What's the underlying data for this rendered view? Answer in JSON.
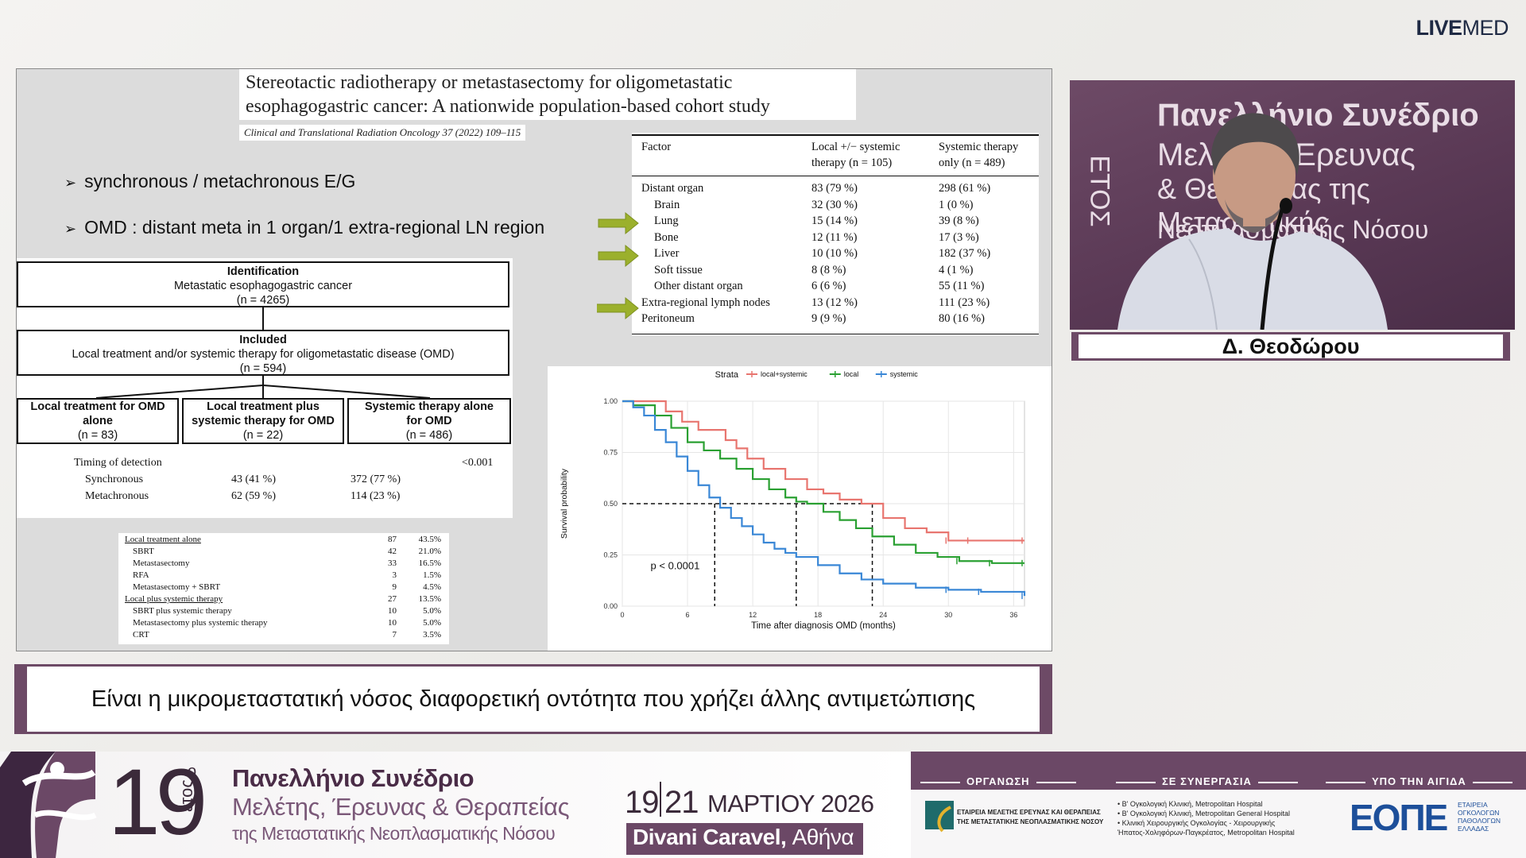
{
  "brand": {
    "live": "LIVE",
    "med": "MED"
  },
  "slide": {
    "paper_title_line1": "Stereotactic radiotherapy or metastasectomy for oligometastatic",
    "paper_title_line2": "esophagogastric cancer: A nationwide population-based cohort study",
    "journal": "Clinical and Translational Radiation Oncology 37 (2022) 109–115",
    "bullets": [
      "synchronous / metachronous E/G",
      "OMD : distant meta in 1 organ/1 extra-regional LN region"
    ],
    "flow": {
      "identification_title": "Identification",
      "identification_text": "Metastatic esophagogastric cancer",
      "identification_n": "(n = 4265)",
      "included_title": "Included",
      "included_text": "Local treatment and/or systemic therapy for oligometastatic disease (OMD)",
      "included_n": "(n = 594)",
      "branches": [
        {
          "line1": "Local treatment for OMD",
          "line2": "alone",
          "n": "(n = 83)"
        },
        {
          "line1": "Local treatment plus",
          "line2": "systemic therapy for OMD",
          "n": "(n = 22)"
        },
        {
          "line1": "Systemic therapy alone",
          "line2": "for OMD",
          "n": "(n = 486)"
        }
      ],
      "timing_label": "Timing of detection",
      "timing_p": "<0.001",
      "timing_rows": [
        {
          "label": "Synchronous",
          "a": "43 (41 %)",
          "b": "372 (77 %)"
        },
        {
          "label": "Metachronous",
          "a": "62 (59 %)",
          "b": "114 (23 %)"
        }
      ]
    },
    "treatment_table": [
      {
        "label": "Local treatment alone",
        "n": "87",
        "p": "43.5%",
        "head": true
      },
      {
        "label": "SBRT",
        "n": "42",
        "p": "21.0%"
      },
      {
        "label": "Metastasectomy",
        "n": "33",
        "p": "16.5%"
      },
      {
        "label": "RFA",
        "n": "3",
        "p": "1.5%"
      },
      {
        "label": "Metastasectomy + SBRT",
        "n": "9",
        "p": "4.5%"
      },
      {
        "label": "Local plus systemic therapy",
        "n": "27",
        "p": "13.5%",
        "head": true
      },
      {
        "label": "SBRT plus systemic therapy",
        "n": "10",
        "p": "5.0%"
      },
      {
        "label": "Metastasectomy plus systemic therapy",
        "n": "10",
        "p": "5.0%"
      },
      {
        "label": "CRT",
        "n": "7",
        "p": "3.5%"
      }
    ],
    "factor_table": {
      "headers": [
        "Factor",
        "Local +/− systemic",
        "therapy (n = 105)",
        "Systemic therapy",
        "only (n = 489)"
      ],
      "rows": [
        {
          "label": "Distant organ",
          "a": "83 (79 %)",
          "b": "298 (61 %)",
          "indent": false
        },
        {
          "label": "Brain",
          "a": "32 (30 %)",
          "b": "1 (0 %)",
          "indent": true
        },
        {
          "label": "Lung",
          "a": "15 (14 %)",
          "b": "39 (8 %)",
          "indent": true,
          "arrow": true
        },
        {
          "label": "Bone",
          "a": "12 (11 %)",
          "b": "17 (3 %)",
          "indent": true
        },
        {
          "label": "Liver",
          "a": "10 (10 %)",
          "b": "182 (37 %)",
          "indent": true,
          "arrow": true
        },
        {
          "label": "Soft tissue",
          "a": "8 (8 %)",
          "b": "4 (1 %)",
          "indent": true
        },
        {
          "label": "Other distant organ",
          "a": "6 (6 %)",
          "b": "55 (11 %)",
          "indent": true
        },
        {
          "label": "Extra-regional lymph nodes",
          "a": "13 (12 %)",
          "b": "111 (23 %)",
          "indent": false,
          "arrow": true
        },
        {
          "label": "Peritoneum",
          "a": "9 (9 %)",
          "b": "80 (16 %)",
          "indent": false
        }
      ]
    }
  },
  "chart_data": {
    "type": "line",
    "legend_title": "Strata",
    "legend_placement": "top",
    "xlabel": "Time after diagnosis OMD (months)",
    "ylabel": "Survival probability",
    "xlim": [
      0,
      37
    ],
    "ylim": [
      0,
      1
    ],
    "x_ticks": [
      "0",
      "6",
      "12",
      "18",
      "24",
      "30",
      "36"
    ],
    "y_ticks": [
      "0.00",
      "0.25",
      "0.50",
      "0.75",
      "1.00"
    ],
    "annotation": "p < 0.0001",
    "median_lines": [
      8.5,
      16,
      23
    ],
    "series": [
      {
        "name": "local+systemic",
        "color": "#e8756f",
        "x": [
          0,
          2.5,
          4,
          5.5,
          7,
          8,
          9.5,
          10.5,
          11.5,
          13,
          15,
          17,
          18.5,
          20,
          22,
          24,
          26,
          28,
          30,
          32,
          37
        ],
        "y": [
          1.0,
          1.0,
          0.95,
          0.9,
          0.86,
          0.86,
          0.81,
          0.77,
          0.72,
          0.67,
          0.62,
          0.57,
          0.55,
          0.52,
          0.5,
          0.43,
          0.38,
          0.36,
          0.32,
          0.32,
          0.32
        ]
      },
      {
        "name": "local",
        "color": "#2aa032",
        "x": [
          0,
          1,
          3,
          4.5,
          6,
          7.5,
          9,
          10.5,
          12,
          13.5,
          15,
          16,
          17,
          18.5,
          20,
          21.5,
          23,
          25,
          27,
          29,
          31,
          34,
          37
        ],
        "y": [
          1.0,
          0.98,
          0.93,
          0.87,
          0.8,
          0.76,
          0.72,
          0.67,
          0.62,
          0.57,
          0.53,
          0.51,
          0.5,
          0.46,
          0.42,
          0.38,
          0.34,
          0.3,
          0.26,
          0.24,
          0.22,
          0.21,
          0.21
        ]
      },
      {
        "name": "systemic",
        "color": "#3a87d6",
        "x": [
          0,
          1,
          2,
          3,
          4,
          5,
          6,
          7,
          8,
          9,
          10,
          11,
          12,
          13,
          14,
          15,
          16,
          18,
          20,
          22,
          24,
          27,
          30,
          33,
          37
        ],
        "y": [
          1.0,
          0.97,
          0.93,
          0.86,
          0.8,
          0.73,
          0.66,
          0.59,
          0.53,
          0.48,
          0.43,
          0.39,
          0.35,
          0.31,
          0.28,
          0.26,
          0.24,
          0.2,
          0.16,
          0.13,
          0.11,
          0.09,
          0.08,
          0.07,
          0.05
        ]
      }
    ]
  },
  "video": {
    "bg_text_lines": [
      "Πανελλήνιο Συνέδριο",
      "Μελέτης, Έρευνας",
      "& Θεραπείας της Μεταστατικής",
      "Νεοπλασματικής Νόσου"
    ],
    "side_text": "ΕΤΟΣ",
    "speaker_name": "Δ. Θεοδώρου"
  },
  "caption": "Είναι η μικρομεταστατική νόσος διαφορετική οντότητα που χρήζει άλλης αντιμετώπισης",
  "footer": {
    "edition": "19",
    "edition_sup": "ο",
    "edition_word": "έτος",
    "congress_line1": "Πανελλήνιο Συνέδριο",
    "congress_line2": "Μελέτης, Έρευνας & Θεραπείας",
    "congress_line3": "της Μεταστατικής Νεοπλασματικής Νόσου",
    "dates_a": "19",
    "dates_b": "21",
    "month": "ΜΑΡΤΙΟΥ 2026",
    "venue_bold": "Divani Caravel,",
    "venue_city": "Αθήνα",
    "organization_label": "ΟΡΓΑΝΩΣΗ",
    "cooperation_label": "ΣΕ ΣΥΝΕΡΓΑΣΙΑ",
    "auspices_label": "ΥΠΟ ΤΗΝ ΑΙΓΙΔΑ",
    "org_text_1": "ΕΤΑΙΡΕΙΑ ΜΕΛΕΤΗΣ ΕΡΕΥΝΑΣ ΚΑΙ ΘΕΡΑΠΕΙΑΣ",
    "org_text_2": "ΤΗΣ ΜΕΤΑΣΤΑΤΙΚΗΣ ΝΕΟΠΛΑΣΜΑΤΙΚΗΣ ΝΟΣΟΥ",
    "coop_lines": [
      "• Β' Ογκολογική Κλινική, Metropolitan Hospital",
      "• Β' Ογκολογική Κλινική, Metropolitan General Hospital",
      "• Κλινική Χειρουργικής Ογκολογίας - Χειρουργικής",
      "  Ήπατος-Χοληφόρων-Παγκρέατος, Metropolitan Hospital"
    ],
    "eope_logo": "ΕΟΠΕ",
    "eope_lines": [
      "ΕΤΑΙΡΕΙΑ",
      "ΟΓΚΟΛΟΓΩΝ",
      "ΠΑΘΟΛΟΓΩΝ",
      "ΕΛΛΑΔΑΣ"
    ]
  }
}
